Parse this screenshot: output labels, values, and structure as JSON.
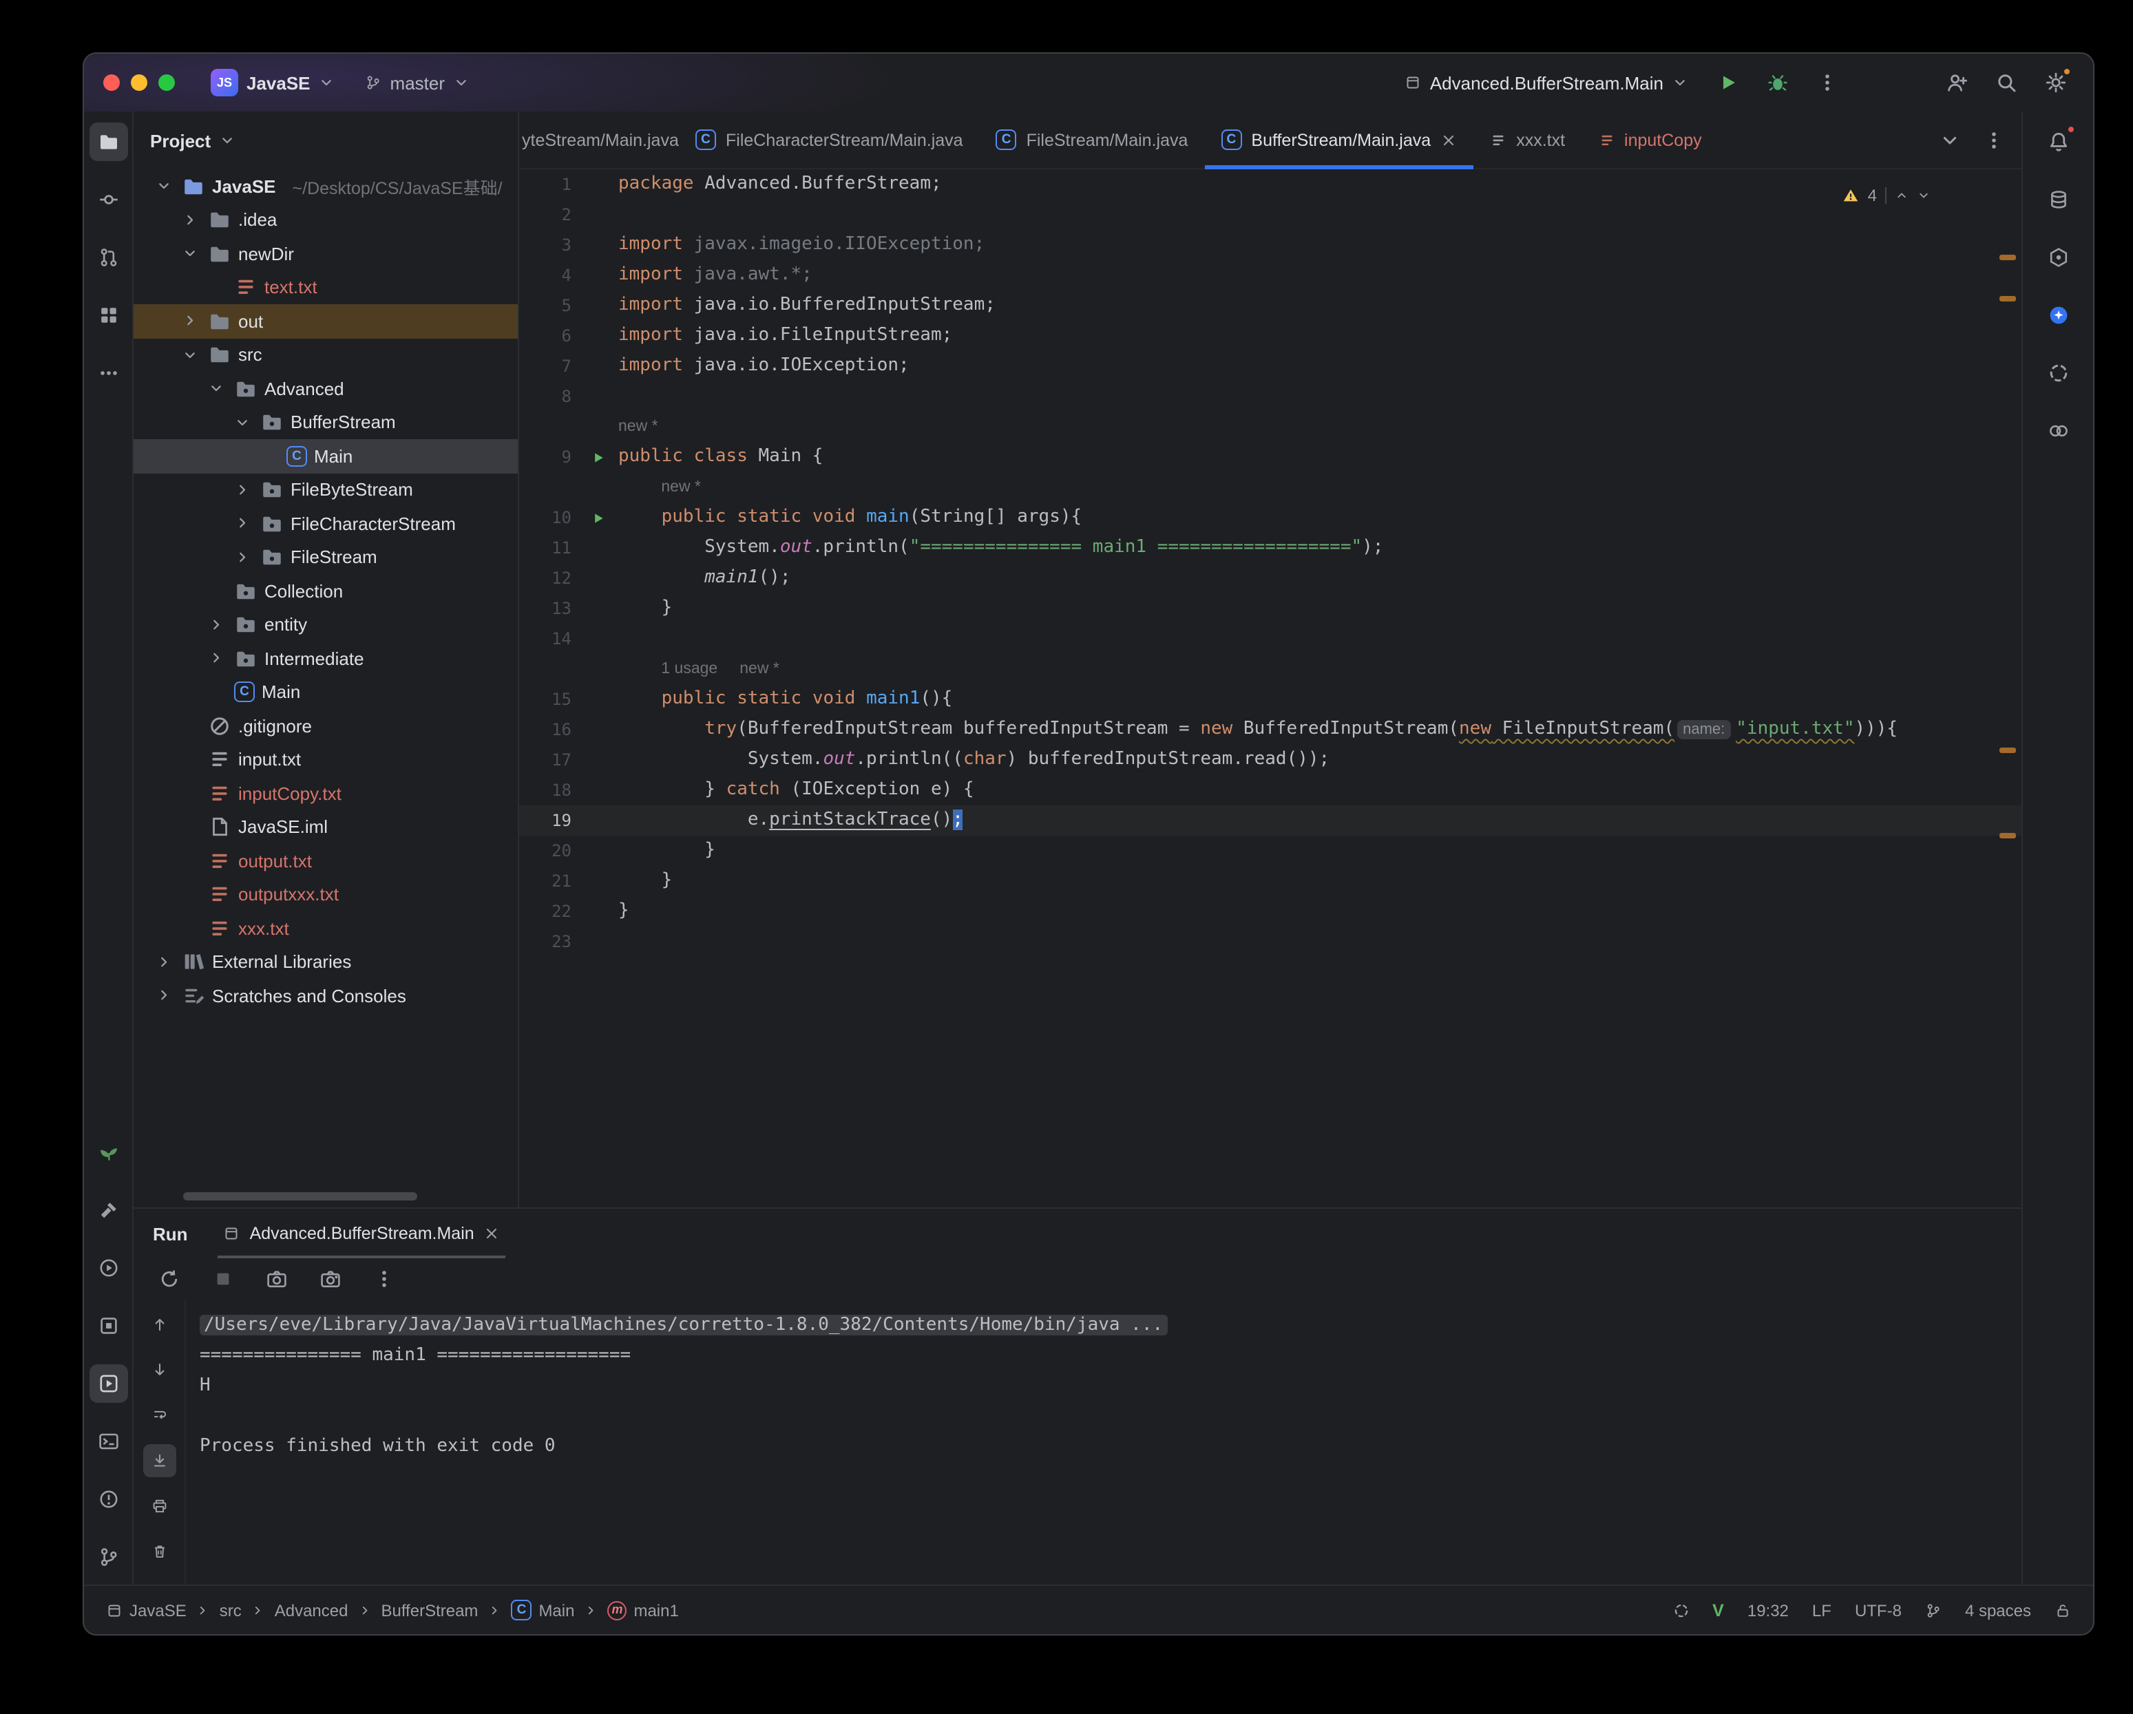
{
  "titlebar": {
    "badge": "JS",
    "project": "JavaSE",
    "branch": "master",
    "run_config": "Advanced.BufferStream.Main"
  },
  "left_strip": {
    "top": [
      {
        "icon": "folder",
        "name": "project-tool",
        "selected": true
      },
      {
        "icon": "commit",
        "name": "commit-tool"
      },
      {
        "icon": "pr",
        "name": "pull-requests-tool"
      },
      {
        "icon": "structure",
        "name": "structure-tool"
      },
      {
        "icon": "more-h",
        "name": "more-tool-windows"
      }
    ],
    "bottom": [
      {
        "icon": "seedling",
        "name": "plugins-tool",
        "green": true
      },
      {
        "icon": "hammer",
        "name": "build-tool"
      },
      {
        "icon": "services",
        "name": "services-tool"
      },
      {
        "icon": "layers",
        "name": "coverage-tool"
      },
      {
        "icon": "run-box",
        "name": "run-tool",
        "selected": true
      },
      {
        "icon": "terminal",
        "name": "terminal-tool"
      },
      {
        "icon": "problems",
        "name": "problems-tool"
      },
      {
        "icon": "branch",
        "name": "version-control-tool"
      }
    ]
  },
  "right_strip": {
    "top": [
      {
        "icon": "bell",
        "name": "notifications",
        "dot": "red"
      },
      {
        "icon": "db",
        "name": "database-tool"
      },
      {
        "icon": "hexagon",
        "name": "dependencies-tool"
      },
      {
        "icon": "ai-circle",
        "name": "ai-assistant-tool"
      },
      {
        "icon": "swirl",
        "name": "chatgpt-tool"
      },
      {
        "icon": "pair",
        "name": "collaboration-tool"
      }
    ]
  },
  "project_panel": {
    "title": "Project",
    "tree": [
      {
        "label": "JavaSE",
        "suffix": "~/Desktop/CS/JavaSE基础/",
        "level": 0,
        "chev": "down",
        "icon": "folder",
        "root": true,
        "bold": true
      },
      {
        "label": ".idea",
        "level": 1,
        "chev": "right",
        "icon": "folder"
      },
      {
        "label": "newDir",
        "level": 1,
        "chev": "down",
        "icon": "folder"
      },
      {
        "label": "text.txt",
        "level": 2,
        "icon": "file",
        "color": "red"
      },
      {
        "label": "out",
        "level": 1,
        "chev": "right",
        "icon": "folder",
        "highlight": "brown"
      },
      {
        "label": "src",
        "level": 1,
        "chev": "down",
        "icon": "folder"
      },
      {
        "label": "Advanced",
        "level": 2,
        "chev": "down",
        "icon": "package"
      },
      {
        "label": "BufferStream",
        "level": 3,
        "chev": "down",
        "icon": "package"
      },
      {
        "label": "Main",
        "level": 4,
        "icon": "class",
        "highlight": "selected"
      },
      {
        "label": "FileByteStream",
        "level": 3,
        "chev": "right",
        "icon": "package"
      },
      {
        "label": "FileCharacterStream",
        "level": 3,
        "chev": "right",
        "icon": "package"
      },
      {
        "label": "FileStream",
        "level": 3,
        "chev": "right",
        "icon": "package"
      },
      {
        "label": "Collection",
        "level": 2,
        "icon": "package"
      },
      {
        "label": "entity",
        "level": 2,
        "chev": "right",
        "icon": "package"
      },
      {
        "label": "Intermediate",
        "level": 2,
        "chev": "right",
        "icon": "package"
      },
      {
        "label": "Main",
        "level": 2,
        "icon": "class"
      },
      {
        "label": ".gitignore",
        "level": 1,
        "icon": "ignore"
      },
      {
        "label": "input.txt",
        "level": 1,
        "icon": "file"
      },
      {
        "label": "inputCopy.txt",
        "level": 1,
        "icon": "file",
        "color": "red"
      },
      {
        "label": "JavaSE.iml",
        "level": 1,
        "icon": "iml"
      },
      {
        "label": "output.txt",
        "level": 1,
        "icon": "file",
        "color": "red"
      },
      {
        "label": "outputxxx.txt",
        "level": 1,
        "icon": "file",
        "color": "red"
      },
      {
        "label": "xxx.txt",
        "level": 1,
        "icon": "file",
        "color": "red"
      },
      {
        "label": "External Libraries",
        "level": 0,
        "chev": "right",
        "icon": "libs"
      },
      {
        "label": "Scratches and Consoles",
        "level": 0,
        "chev": "right",
        "icon": "scratch"
      }
    ]
  },
  "tabs": {
    "items": [
      {
        "label": "yteStream/Main.java",
        "clipped": true
      },
      {
        "label": "FileCharacterStream/Main.java",
        "icon": "class"
      },
      {
        "label": "FileStream/Main.java",
        "icon": "class"
      },
      {
        "label": "BufferStream/Main.java",
        "icon": "class",
        "active": true,
        "close": true
      },
      {
        "label": "xxx.txt",
        "icon": "file"
      },
      {
        "label": "inputCopy",
        "icon": "file",
        "color": "red"
      }
    ]
  },
  "editor": {
    "inspection_count": "4",
    "stripe_marks": [
      62,
      92,
      420,
      482
    ],
    "rows": [
      {
        "n": "1",
        "seg": [
          [
            "k",
            "package"
          ],
          [
            "d",
            " Advanced.BufferStream;"
          ]
        ]
      },
      {
        "n": "2",
        "seg": []
      },
      {
        "n": "3",
        "seg": [
          [
            "k",
            "import"
          ],
          [
            "g",
            " javax.imageio.IIOException;"
          ]
        ]
      },
      {
        "n": "4",
        "seg": [
          [
            "k",
            "import"
          ],
          [
            "g",
            " java.awt.*;"
          ]
        ]
      },
      {
        "n": "5",
        "seg": [
          [
            "k",
            "import"
          ],
          [
            "d",
            " java.io.BufferedInputStream;"
          ]
        ]
      },
      {
        "n": "6",
        "seg": [
          [
            "k",
            "import"
          ],
          [
            "d",
            " java.io.FileInputStream;"
          ]
        ]
      },
      {
        "n": "7",
        "seg": [
          [
            "k",
            "import"
          ],
          [
            "d",
            " java.io.IOException;"
          ]
        ]
      },
      {
        "n": "8",
        "seg": []
      },
      {
        "hints": [
          "new *"
        ],
        "indent": 0
      },
      {
        "n": "9",
        "run": true,
        "seg": [
          [
            "k",
            "public"
          ],
          [
            "d",
            " "
          ],
          [
            "k",
            "class"
          ],
          [
            "d",
            " Main {"
          ]
        ]
      },
      {
        "hints": [
          "new *"
        ],
        "indent": 4
      },
      {
        "n": "10",
        "run": true,
        "seg": [
          [
            "d",
            "    "
          ],
          [
            "k",
            "public"
          ],
          [
            "d",
            " "
          ],
          [
            "k",
            "static"
          ],
          [
            "d",
            " "
          ],
          [
            "k",
            "void"
          ],
          [
            "d",
            " "
          ],
          [
            "m",
            "main"
          ],
          [
            "d",
            "(String[] args){"
          ]
        ]
      },
      {
        "n": "11",
        "seg": [
          [
            "d",
            "        System."
          ],
          [
            "p",
            "out"
          ],
          [
            "d",
            ".println("
          ],
          [
            "s",
            "\"=============== main1 ==================\""
          ],
          [
            "d",
            ");"
          ]
        ]
      },
      {
        "n": "12",
        "seg": [
          [
            "d",
            "        "
          ],
          [
            "i",
            "main1"
          ],
          [
            "d",
            "();"
          ]
        ]
      },
      {
        "n": "13",
        "seg": [
          [
            "d",
            "    }"
          ]
        ]
      },
      {
        "n": "14",
        "seg": []
      },
      {
        "hints": [
          "1 usage",
          "new *"
        ],
        "indent": 4
      },
      {
        "n": "15",
        "seg": [
          [
            "d",
            "    "
          ],
          [
            "k",
            "public"
          ],
          [
            "d",
            " "
          ],
          [
            "k",
            "static"
          ],
          [
            "d",
            " "
          ],
          [
            "k",
            "void"
          ],
          [
            "d",
            " "
          ],
          [
            "m",
            "main1"
          ],
          [
            "d",
            "(){"
          ]
        ]
      },
      {
        "n": "16",
        "seg": [
          [
            "d",
            "        "
          ],
          [
            "k",
            "try"
          ],
          [
            "d",
            "(BufferedInputStream bufferedInputStream = "
          ],
          [
            "k",
            "new"
          ],
          [
            "d",
            " BufferedInputStream("
          ],
          [
            "wk",
            "new"
          ],
          [
            "wd",
            " FileInputStream("
          ],
          [
            "chip",
            "name:"
          ],
          [
            "ws",
            "\"input.txt\""
          ],
          [
            "d",
            "))){"
          ]
        ]
      },
      {
        "n": "17",
        "seg": [
          [
            "d",
            "            System."
          ],
          [
            "p",
            "out"
          ],
          [
            "d",
            ".println(("
          ],
          [
            "k",
            "char"
          ],
          [
            "d",
            ") bufferedInputStream.read());"
          ]
        ]
      },
      {
        "n": "18",
        "seg": [
          [
            "d",
            "        } "
          ],
          [
            "k",
            "catch"
          ],
          [
            "d",
            " (IOException e) {"
          ]
        ]
      },
      {
        "n": "19",
        "current": true,
        "seg": [
          [
            "d",
            "            e."
          ],
          [
            "u",
            "printStackTrace"
          ],
          [
            "d",
            "()"
          ],
          [
            "cur",
            ";"
          ]
        ]
      },
      {
        "n": "20",
        "seg": [
          [
            "d",
            "        }"
          ]
        ]
      },
      {
        "n": "21",
        "seg": [
          [
            "d",
            "    }"
          ]
        ]
      },
      {
        "n": "22",
        "seg": [
          [
            "d",
            "}"
          ]
        ]
      },
      {
        "n": "23",
        "seg": []
      }
    ]
  },
  "run_panel": {
    "title": "Run",
    "tab": "Advanced.BufferStream.Main",
    "toolbar": [
      {
        "icon": "rerun",
        "name": "rerun-button"
      },
      {
        "icon": "stop",
        "name": "stop-button",
        "disabled": true
      },
      {
        "icon": "camera",
        "name": "dump-threads-button"
      },
      {
        "icon": "camera-dot",
        "name": "memory-snapshot-button"
      },
      {
        "icon": "kebab-v",
        "name": "console-more-options-button"
      }
    ],
    "gutter": [
      {
        "icon": "arrow-up",
        "name": "prev-occurrence-button"
      },
      {
        "icon": "arrow-down",
        "name": "next-occurrence-button"
      },
      {
        "icon": "softwrap",
        "name": "soft-wrap-button"
      },
      {
        "icon": "scrollend",
        "name": "scroll-to-end-button",
        "selected": true
      },
      {
        "icon": "printer",
        "name": "print-console-button"
      },
      {
        "icon": "trash",
        "name": "clear-console-button"
      }
    ],
    "console": [
      {
        "text": "/Users/eve/Library/Java/JavaVirtualMachines/corretto-1.8.0_382/Contents/Home/bin/java ...",
        "chip": true
      },
      {
        "text": "=============== main1 =================="
      },
      {
        "text": "H"
      },
      {
        "text": ""
      },
      {
        "text": "Process finished with exit code 0"
      }
    ]
  },
  "status_bar": {
    "breadcrumbs": [
      {
        "label": "JavaSE",
        "icon": "module"
      },
      {
        "label": "src"
      },
      {
        "label": "Advanced"
      },
      {
        "label": "BufferStream"
      },
      {
        "label": "Main",
        "icon": "class"
      },
      {
        "label": "main1",
        "icon": "method"
      }
    ],
    "right_items": [
      {
        "icon": "swirl",
        "name": "ai-plugin-status"
      },
      {
        "text": "V",
        "name": "ideavim-status",
        "green": true
      },
      {
        "text": "19:32",
        "name": "cursor-position"
      },
      {
        "text": "LF",
        "name": "line-separator"
      },
      {
        "text": "UTF-8",
        "name": "file-encoding"
      },
      {
        "icon": "branch",
        "name": "vcs-widget"
      },
      {
        "text": "4 spaces",
        "name": "indent-widget"
      },
      {
        "icon": "lock-open",
        "name": "writable-status"
      }
    ]
  }
}
